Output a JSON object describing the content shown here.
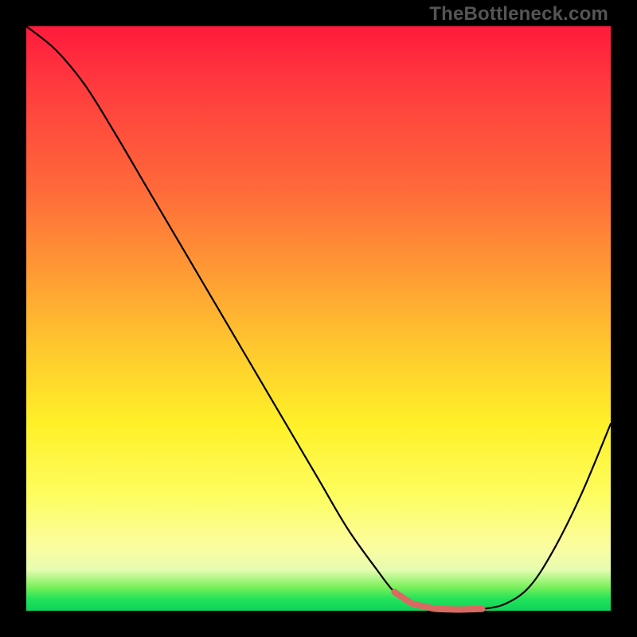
{
  "watermark": "TheBottleneck.com",
  "colors": {
    "frame": "#000000",
    "gradient_top": "#ff1a3c",
    "gradient_bottom": "#0fd45a",
    "curve": "#000000",
    "highlight": "#d86a62"
  },
  "chart_data": {
    "type": "line",
    "title": "",
    "xlabel": "",
    "ylabel": "",
    "xlim": [
      0,
      100
    ],
    "ylim": [
      0,
      100
    ],
    "x": [
      0,
      5,
      10,
      15,
      20,
      25,
      30,
      35,
      40,
      45,
      50,
      55,
      60,
      63,
      66,
      70,
      74,
      78,
      82,
      86,
      90,
      95,
      100
    ],
    "y": [
      100,
      96,
      90,
      82,
      73.5,
      65,
      56.5,
      48,
      39.5,
      31,
      22.5,
      14,
      7,
      3.2,
      1.2,
      0.3,
      0.2,
      0.3,
      1.2,
      4,
      10,
      20,
      32
    ],
    "series": [
      {
        "name": "bottleneck-curve",
        "x": [
          0,
          5,
          10,
          15,
          20,
          25,
          30,
          35,
          40,
          45,
          50,
          55,
          60,
          63,
          66,
          70,
          74,
          78,
          82,
          86,
          90,
          95,
          100
        ],
        "y": [
          100,
          96,
          90,
          82,
          73.5,
          65,
          56.5,
          48,
          39.5,
          31,
          22.5,
          14,
          7,
          3.2,
          1.2,
          0.3,
          0.2,
          0.3,
          1.2,
          4,
          10,
          20,
          32
        ]
      }
    ],
    "highlight_range_x": [
      63,
      78
    ]
  }
}
